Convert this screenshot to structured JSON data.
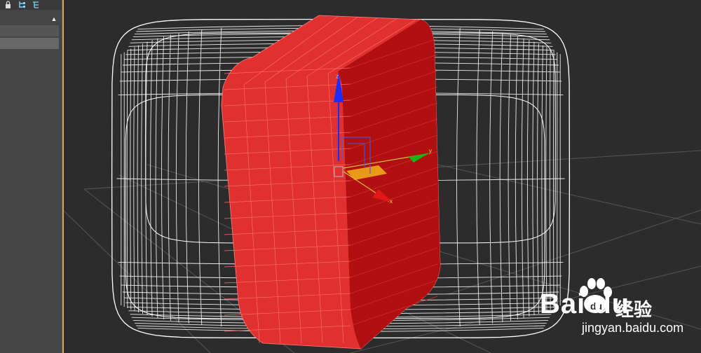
{
  "app": {
    "name": "3D modeling viewport"
  },
  "toolbar": {
    "icons": [
      "lock-icon",
      "hierarchy-icon",
      "hierarchy-link-icon"
    ]
  },
  "panel": {
    "scroll_up_glyph": "▲"
  },
  "gizmo": {
    "z_label": "z",
    "y_label": "y",
    "x_label": "x",
    "colors": {
      "z": "#1c2cff",
      "y": "#18b418",
      "x": "#e01818",
      "plane": "#f2b21a"
    }
  },
  "scene": {
    "selected_color": "#e03030",
    "wire_color": "#ffffff",
    "background": "#2c2c2c"
  },
  "watermark": {
    "brand": "Bai du",
    "brand_cn": "经验",
    "url": "jingyan.baidu.com"
  }
}
